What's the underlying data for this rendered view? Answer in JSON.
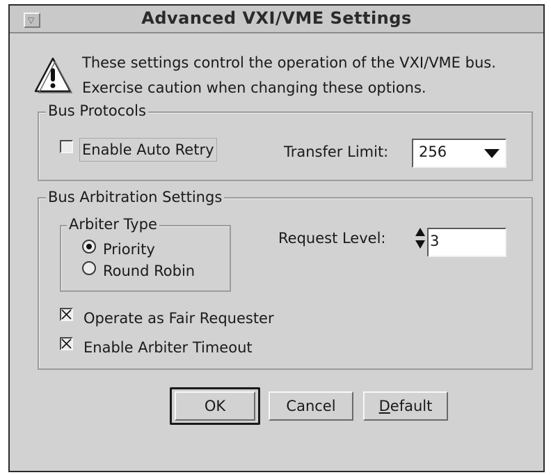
{
  "window": {
    "title": "Advanced VXI/VME Settings",
    "sysmenu_icon": "window-menu-icon"
  },
  "message": {
    "icon": "warning-icon",
    "line1": "These settings control the operation of the VXI/VME bus.",
    "line2": "Exercise caution when changing these options."
  },
  "bus_protocols": {
    "legend": "Bus Protocols",
    "auto_retry_label": "Enable Auto Retry",
    "auto_retry_checked": false,
    "transfer_limit_label": "Transfer Limit:",
    "transfer_limit_value": "256"
  },
  "bus_arbitration": {
    "legend": "Bus Arbitration Settings",
    "arbiter_type": {
      "legend": "Arbiter Type",
      "options": [
        {
          "label": "Priority",
          "selected": true
        },
        {
          "label": "Round Robin",
          "selected": false
        }
      ]
    },
    "request_level_label": "Request Level:",
    "request_level_value": "3",
    "fair_requester_label": "Operate as Fair Requester",
    "fair_requester_checked": true,
    "arbiter_timeout_label": "Enable Arbiter Timeout",
    "arbiter_timeout_checked": true
  },
  "buttons": {
    "ok": "OK",
    "cancel": "Cancel",
    "default_mnemonic": "D",
    "default_rest": "efault"
  }
}
